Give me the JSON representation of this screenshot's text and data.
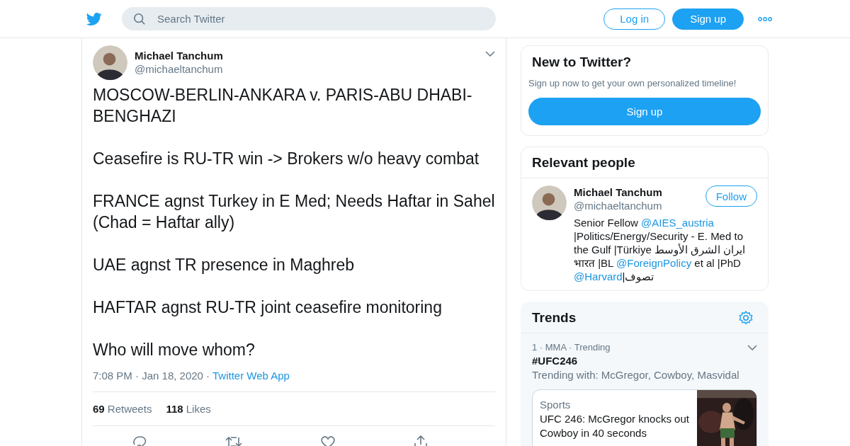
{
  "header": {
    "search": {
      "placeholder": "Search Twitter"
    },
    "buttons": [
      {
        "label": "Log in",
        "kind": "outline"
      },
      {
        "label": "Sign up",
        "kind": "filled"
      }
    ]
  },
  "tweet": {
    "author": {
      "name": "Michael Tanchum",
      "handle": "@michaeltanchum"
    },
    "paragraphs": [
      "MOSCOW-BERLIN-ANKARA v. PARIS-ABU DHABI-BENGHAZI",
      "Ceasefire is RU-TR win -> Brokers w/o heavy combat",
      "FRANCE agnst Turkey in E Med; Needs Haftar in Sahel (Chad = Haftar ally)",
      "UAE agnst TR presence in Maghreb",
      "HAFTAR agnst RU-TR joint ceasefire monitoring",
      "Who will move whom?"
    ],
    "timestamp": "7:08 PM · Jan 18, 2020 ·",
    "source": "Twitter Web App",
    "stats": [
      {
        "count": "69",
        "label": "Retweets"
      },
      {
        "count": "118",
        "label": "Likes"
      }
    ]
  },
  "new_to_twitter": {
    "title": "New to Twitter?",
    "text": "Sign up now to get your own personalized timeline!",
    "button": "Sign up"
  },
  "relevant_people": {
    "title": "Relevant people",
    "people": [
      {
        "name": "Michael Tanchum",
        "handle": "@michaeltanchum",
        "button": "Follow",
        "bio": [
          {
            "kind": "text",
            "text": "Senior Fellow "
          },
          {
            "kind": "link",
            "text": "@AIES_austria"
          },
          {
            "kind": "text",
            "text": " |Politics/Energy/Security - E. Med to the Gulf |Türkiye ایران الشرق الأوسط भारत |BL "
          },
          {
            "kind": "link",
            "text": "@ForeignPolicy"
          },
          {
            "kind": "text",
            "text": " et al |PhD "
          },
          {
            "kind": "link",
            "text": "@Harvard"
          },
          {
            "kind": "text",
            "text": "|تصوف"
          }
        ]
      }
    ]
  },
  "trends": {
    "title": "Trends",
    "items": [
      {
        "meta": "1 · MMA · Trending",
        "name": "#UFC246",
        "context": "Trending with: McGregor, Cowboy, Masvidal",
        "card": {
          "kind": "picture",
          "category": "Sports",
          "headline": "UFC 246: McGregor knocks out Cowboy in 40 seconds"
        }
      }
    ]
  }
}
